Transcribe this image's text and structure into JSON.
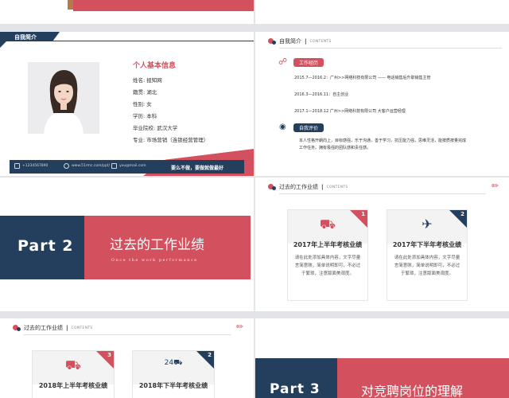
{
  "slide1": {},
  "profile": {
    "tag": "自我简介",
    "info_title": "个人基本信息",
    "rows": [
      {
        "label": "姓名:",
        "value": "担知网"
      },
      {
        "label": "籍贯:",
        "value": "湖北"
      },
      {
        "label": "性别:",
        "value": "女"
      },
      {
        "label": "学历:",
        "value": "本科"
      },
      {
        "label": "毕业院校:",
        "value": "武汉大学"
      },
      {
        "label": "专业:",
        "value": "市场营销（连锁经营管理）"
      }
    ],
    "footer": {
      "phone": "+1234567890",
      "website": "www.51rmc.com/ppt/",
      "email": "you@mail.com",
      "slogan": "要么不做，要做就做最好"
    },
    "icons": [
      "phone-icon",
      "globe-icon",
      "mail-icon"
    ]
  },
  "resume": {
    "title": "自我简介",
    "subtitle": "CONTENTS",
    "experience_label": "工作经历",
    "experience": [
      "2015.7—2016.2：广州>>网络科技有限公司 —— 电话销售后升职销售主管",
      "2016.3—2016.11：自主创业",
      "2017.1—2018.12 广州>>网络科技有限公司 大客户运营经理"
    ],
    "evaluation_label": "自我评价",
    "evaluation": "本人性格开朗向上，目标感强，乐于沟通，善于学习，抗压能力强，思维灵活，能按质按量完成工作任务。拥有极强的团队感和责任感。"
  },
  "part2": {
    "part": "Part 2",
    "title": "过去的工作业绩",
    "subtitle": "Once the work performance"
  },
  "past_2017": {
    "title": "过去的工作业绩",
    "subtitle": "CONTENTS",
    "cards": [
      {
        "num": "1",
        "title": "2017年上半年考核业绩",
        "body": "请在此处添加具体内容，文字尽量言简意赅，简单说明即可，不必过于繁琐，注意版面美观度。",
        "icon": "truck-icon",
        "corner": "#d3505e"
      },
      {
        "num": "2",
        "title": "2017年下半年考核业绩",
        "body": "请在此处添加具体内容，文字尽量言简意赅，简单说明即可，不必过于繁琐，注意版面美观度。",
        "icon": "airplane-icon",
        "corner": "#243f5e"
      }
    ]
  },
  "past_2018": {
    "title": "过去的工作业绩",
    "subtitle": "CONTENTS",
    "cards": [
      {
        "num": "3",
        "title": "2018年上半年考核业绩",
        "icon": "truck-icon",
        "corner": "#d3505e"
      },
      {
        "num": "2",
        "title": "2018年下半年考核业绩",
        "icon": "24h-delivery-icon",
        "icon_text": "24",
        "corner": "#243f5e"
      }
    ]
  },
  "part3": {
    "part": "Part 3",
    "title": "对竞聘岗位的理解"
  },
  "colors": {
    "navy": "#243f5e",
    "pink": "#d3505e"
  }
}
